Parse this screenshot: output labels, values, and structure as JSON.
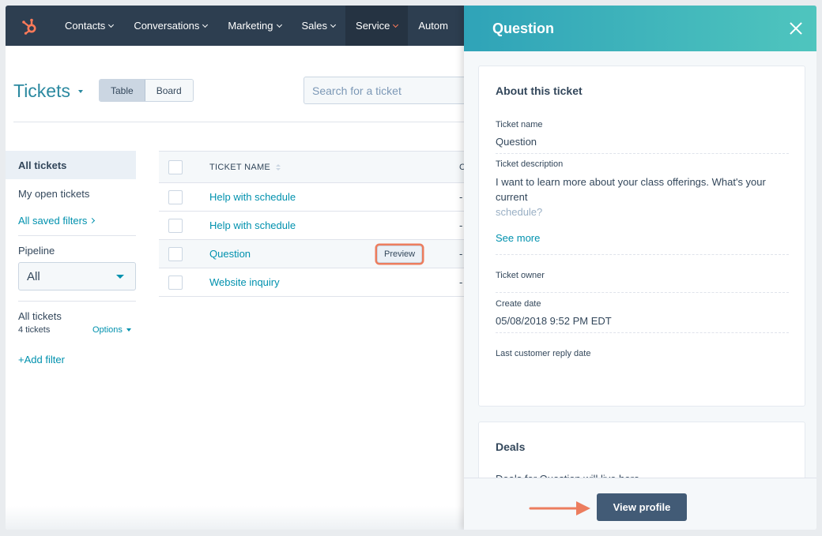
{
  "nav": {
    "items": [
      {
        "label": "Contacts"
      },
      {
        "label": "Conversations"
      },
      {
        "label": "Marketing"
      },
      {
        "label": "Sales"
      },
      {
        "label": "Service"
      },
      {
        "label": "Autom"
      }
    ],
    "accent": "#ff7a59"
  },
  "header": {
    "title": "Tickets",
    "view_table": "Table",
    "view_board": "Board",
    "search_placeholder": "Search for a ticket"
  },
  "sidebar": {
    "all_tickets": "All tickets",
    "my_open": "My open tickets",
    "saved_filters": "All saved filters",
    "pipeline_label": "Pipeline",
    "pipeline_value": "All",
    "view_title": "All tickets",
    "view_count": "4 tickets",
    "options": "Options",
    "add_filter": "+Add filter"
  },
  "table": {
    "col_name": "TICKET NAME",
    "col_c": "C",
    "rows": [
      {
        "name": "Help with schedule",
        "c": "-"
      },
      {
        "name": "Help with schedule",
        "c": "-"
      },
      {
        "name": "Question",
        "c": "-"
      },
      {
        "name": "Website inquiry",
        "c": "-"
      }
    ],
    "preview_label": "Preview"
  },
  "panel": {
    "title": "Question",
    "about_title": "About this ticket",
    "ticket_name_label": "Ticket name",
    "ticket_name_value": "Question",
    "desc_label": "Ticket description",
    "desc_value_1": "I want to learn more about your class offerings. What's your current",
    "desc_value_2": "schedule?",
    "see_more": "See more",
    "owner_label": "Ticket owner",
    "create_label": "Create date",
    "create_value": "05/08/2018 9:52 PM EDT",
    "last_reply_label": "Last customer reply date",
    "deals_title": "Deals",
    "deals_text": "Deals for Question will live here",
    "view_profile": "View profile"
  }
}
